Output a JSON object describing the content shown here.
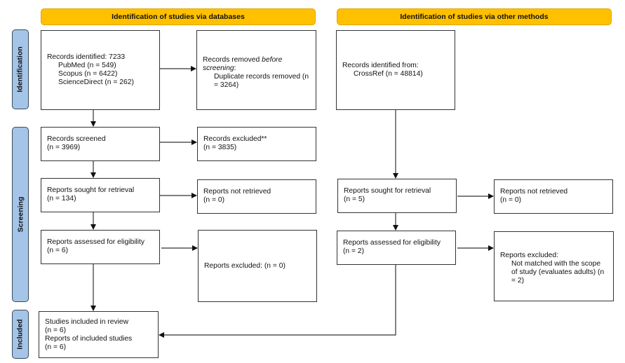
{
  "headers": {
    "databases": "Identification of studies via databases",
    "other_methods": "Identification of studies via other methods"
  },
  "phases": {
    "identification": "Identification",
    "screening": "Screening",
    "included": "Included"
  },
  "colors": {
    "header_fill": "#FFC000",
    "phase_fill": "#A4C4E8",
    "box_border": "#333333"
  },
  "databases": {
    "records_identified": {
      "title": "Records identified: 7233",
      "sources": [
        "PubMed (n = 549)",
        "Scopus (n = 6422)",
        "ScienceDirect (n = 262)"
      ]
    },
    "records_removed": {
      "title_prefix": "Records removed ",
      "title_italic": "before screening",
      "title_suffix": ":",
      "detail": "Duplicate records removed (n = 3264)"
    },
    "records_screened": {
      "title": "Records screened",
      "count": "(n = 3969)"
    },
    "records_excluded": {
      "title": "Records excluded**",
      "count": "(n = 3835)"
    },
    "reports_sought": {
      "title": "Reports sought for retrieval",
      "count": "(n = 134)"
    },
    "reports_not_retrieved": {
      "title": "Reports not retrieved",
      "count": "(n = 0)"
    },
    "reports_assessed": {
      "title": "Reports assessed for eligibility",
      "count": "(n = 6)"
    },
    "reports_excluded": {
      "title": "Reports excluded: (n = 0)"
    }
  },
  "other_methods": {
    "records_identified": {
      "title": "Records identified from:",
      "source": "CrossRef (n = 48814)"
    },
    "reports_sought": {
      "title": "Reports sought for retrieval",
      "count": "(n = 5)"
    },
    "reports_not_retrieved": {
      "title": "Reports not retrieved",
      "count": "(n = 0)"
    },
    "reports_assessed": {
      "title": "Reports assessed for eligibility",
      "count": "(n = 2)"
    },
    "reports_excluded": {
      "title": "Reports excluded:",
      "detail": "Not matched with the scope of study (evaluates adults) (n = 2)"
    }
  },
  "included": {
    "studies_title": "Studies included in review",
    "studies_count": "(n = 6)",
    "reports_title": "Reports of included studies",
    "reports_count": "(n = 6)"
  }
}
